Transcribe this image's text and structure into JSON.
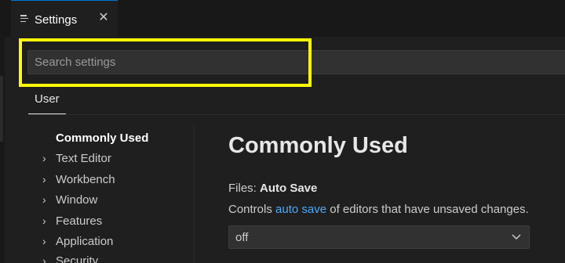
{
  "tab": {
    "label": "Settings",
    "close": "✕"
  },
  "search": {
    "placeholder": "Search settings",
    "value": ""
  },
  "scope_tabs": [
    {
      "label": "User",
      "selected": true
    }
  ],
  "toc": [
    {
      "label": "Commonly Used",
      "active": true,
      "expandable": false
    },
    {
      "label": "Text Editor",
      "expandable": true
    },
    {
      "label": "Workbench",
      "expandable": true
    },
    {
      "label": "Window",
      "expandable": true
    },
    {
      "label": "Features",
      "expandable": true
    },
    {
      "label": "Application",
      "expandable": true
    },
    {
      "label": "Security",
      "expandable": true
    }
  ],
  "content": {
    "title": "Commonly Used",
    "setting": {
      "category": "Files: ",
      "name": "Auto Save",
      "desc_prefix": "Controls ",
      "desc_link": "auto save",
      "desc_suffix": " of editors that have unsaved changes.",
      "value": "off"
    }
  },
  "colors": {
    "background": "#1f1f1f",
    "tabbar": "#181818",
    "link": "#4daafc",
    "highlight": "#ffff00",
    "input_bg": "#313131"
  },
  "icons": {
    "tab": "settings-file-icon",
    "chevron": "chevron-right-icon",
    "dropdown": "chevron-down-icon"
  }
}
